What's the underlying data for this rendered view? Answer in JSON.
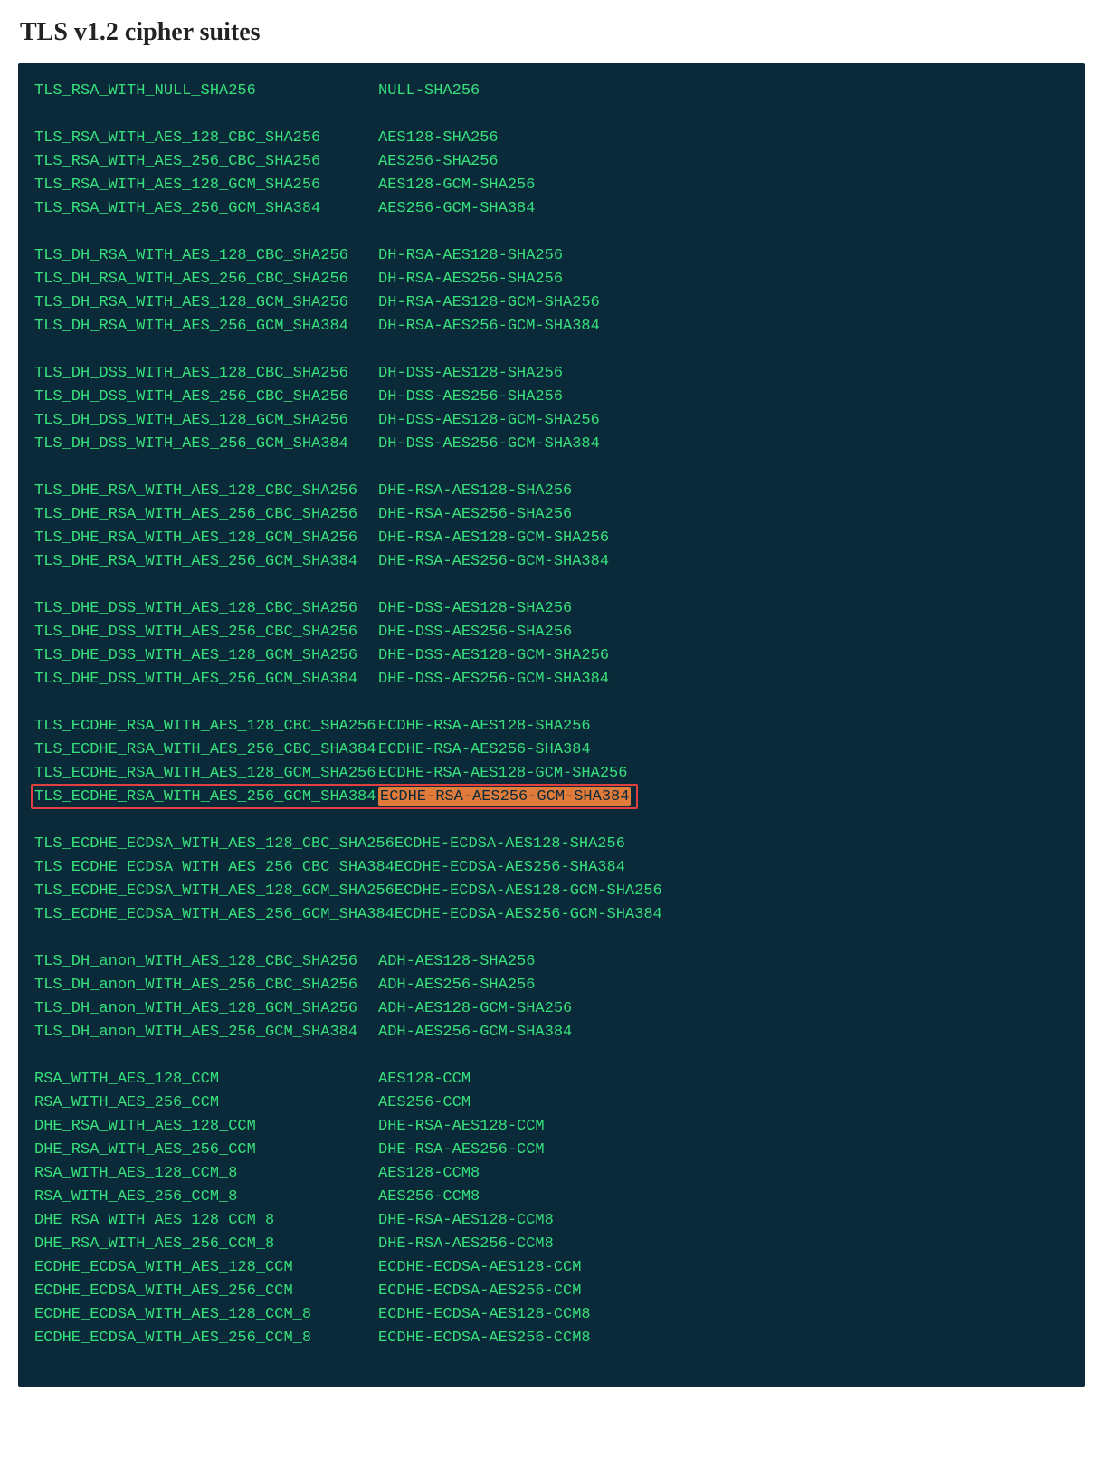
{
  "heading": "TLS v1.2 cipher suites",
  "highlight_index": 24,
  "rows": [
    {
      "l": "TLS_RSA_WITH_NULL_SHA256",
      "r": "NULL-SHA256"
    },
    null,
    {
      "l": "TLS_RSA_WITH_AES_128_CBC_SHA256",
      "r": "AES128-SHA256"
    },
    {
      "l": "TLS_RSA_WITH_AES_256_CBC_SHA256",
      "r": "AES256-SHA256"
    },
    {
      "l": "TLS_RSA_WITH_AES_128_GCM_SHA256",
      "r": "AES128-GCM-SHA256"
    },
    {
      "l": "TLS_RSA_WITH_AES_256_GCM_SHA384",
      "r": "AES256-GCM-SHA384"
    },
    null,
    {
      "l": "TLS_DH_RSA_WITH_AES_128_CBC_SHA256",
      "r": "DH-RSA-AES128-SHA256"
    },
    {
      "l": "TLS_DH_RSA_WITH_AES_256_CBC_SHA256",
      "r": "DH-RSA-AES256-SHA256"
    },
    {
      "l": "TLS_DH_RSA_WITH_AES_128_GCM_SHA256",
      "r": "DH-RSA-AES128-GCM-SHA256"
    },
    {
      "l": "TLS_DH_RSA_WITH_AES_256_GCM_SHA384",
      "r": "DH-RSA-AES256-GCM-SHA384"
    },
    null,
    {
      "l": "TLS_DH_DSS_WITH_AES_128_CBC_SHA256",
      "r": "DH-DSS-AES128-SHA256"
    },
    {
      "l": "TLS_DH_DSS_WITH_AES_256_CBC_SHA256",
      "r": "DH-DSS-AES256-SHA256"
    },
    {
      "l": "TLS_DH_DSS_WITH_AES_128_GCM_SHA256",
      "r": "DH-DSS-AES128-GCM-SHA256"
    },
    {
      "l": "TLS_DH_DSS_WITH_AES_256_GCM_SHA384",
      "r": "DH-DSS-AES256-GCM-SHA384"
    },
    null,
    {
      "l": "TLS_DHE_RSA_WITH_AES_128_CBC_SHA256",
      "r": "DHE-RSA-AES128-SHA256"
    },
    {
      "l": "TLS_DHE_RSA_WITH_AES_256_CBC_SHA256",
      "r": "DHE-RSA-AES256-SHA256"
    },
    {
      "l": "TLS_DHE_RSA_WITH_AES_128_GCM_SHA256",
      "r": "DHE-RSA-AES128-GCM-SHA256"
    },
    {
      "l": "TLS_DHE_RSA_WITH_AES_256_GCM_SHA384",
      "r": "DHE-RSA-AES256-GCM-SHA384"
    },
    null,
    {
      "l": "TLS_DHE_DSS_WITH_AES_128_CBC_SHA256",
      "r": "DHE-DSS-AES128-SHA256"
    },
    {
      "l": "TLS_DHE_DSS_WITH_AES_256_CBC_SHA256",
      "r": "DHE-DSS-AES256-SHA256"
    },
    {
      "l": "TLS_DHE_DSS_WITH_AES_128_GCM_SHA256",
      "r": "DHE-DSS-AES128-GCM-SHA256"
    },
    {
      "l": "TLS_DHE_DSS_WITH_AES_256_GCM_SHA384",
      "r": "DHE-DSS-AES256-GCM-SHA384"
    },
    null,
    {
      "l": "TLS_ECDHE_RSA_WITH_AES_128_CBC_SHA256",
      "r": "ECDHE-RSA-AES128-SHA256"
    },
    {
      "l": "TLS_ECDHE_RSA_WITH_AES_256_CBC_SHA384",
      "r": "ECDHE-RSA-AES256-SHA384"
    },
    {
      "l": "TLS_ECDHE_RSA_WITH_AES_128_GCM_SHA256",
      "r": "ECDHE-RSA-AES128-GCM-SHA256"
    },
    {
      "l": "TLS_ECDHE_RSA_WITH_AES_256_GCM_SHA384",
      "r": "ECDHE-RSA-AES256-GCM-SHA384",
      "highlight": true
    },
    null,
    {
      "l": "TLS_ECDHE_ECDSA_WITH_AES_128_CBC_SHA256",
      "r": "ECDHE-ECDSA-AES128-SHA256"
    },
    {
      "l": "TLS_ECDHE_ECDSA_WITH_AES_256_CBC_SHA384",
      "r": "ECDHE-ECDSA-AES256-SHA384"
    },
    {
      "l": "TLS_ECDHE_ECDSA_WITH_AES_128_GCM_SHA256",
      "r": "ECDHE-ECDSA-AES128-GCM-SHA256"
    },
    {
      "l": "TLS_ECDHE_ECDSA_WITH_AES_256_GCM_SHA384",
      "r": "ECDHE-ECDSA-AES256-GCM-SHA384"
    },
    null,
    {
      "l": "TLS_DH_anon_WITH_AES_128_CBC_SHA256",
      "r": "ADH-AES128-SHA256"
    },
    {
      "l": "TLS_DH_anon_WITH_AES_256_CBC_SHA256",
      "r": "ADH-AES256-SHA256"
    },
    {
      "l": "TLS_DH_anon_WITH_AES_128_GCM_SHA256",
      "r": "ADH-AES128-GCM-SHA256"
    },
    {
      "l": "TLS_DH_anon_WITH_AES_256_GCM_SHA384",
      "r": "ADH-AES256-GCM-SHA384"
    },
    null,
    {
      "l": "RSA_WITH_AES_128_CCM",
      "r": "AES128-CCM"
    },
    {
      "l": "RSA_WITH_AES_256_CCM",
      "r": "AES256-CCM"
    },
    {
      "l": "DHE_RSA_WITH_AES_128_CCM",
      "r": "DHE-RSA-AES128-CCM"
    },
    {
      "l": "DHE_RSA_WITH_AES_256_CCM",
      "r": "DHE-RSA-AES256-CCM"
    },
    {
      "l": "RSA_WITH_AES_128_CCM_8",
      "r": "AES128-CCM8"
    },
    {
      "l": "RSA_WITH_AES_256_CCM_8",
      "r": "AES256-CCM8"
    },
    {
      "l": "DHE_RSA_WITH_AES_128_CCM_8",
      "r": "DHE-RSA-AES128-CCM8"
    },
    {
      "l": "DHE_RSA_WITH_AES_256_CCM_8",
      "r": "DHE-RSA-AES256-CCM8"
    },
    {
      "l": "ECDHE_ECDSA_WITH_AES_128_CCM",
      "r": "ECDHE-ECDSA-AES128-CCM"
    },
    {
      "l": "ECDHE_ECDSA_WITH_AES_256_CCM",
      "r": "ECDHE-ECDSA-AES256-CCM"
    },
    {
      "l": "ECDHE_ECDSA_WITH_AES_128_CCM_8",
      "r": "ECDHE-ECDSA-AES128-CCM8"
    },
    {
      "l": "ECDHE_ECDSA_WITH_AES_256_CCM_8",
      "r": "ECDHE-ECDSA-AES256-CCM8"
    }
  ]
}
